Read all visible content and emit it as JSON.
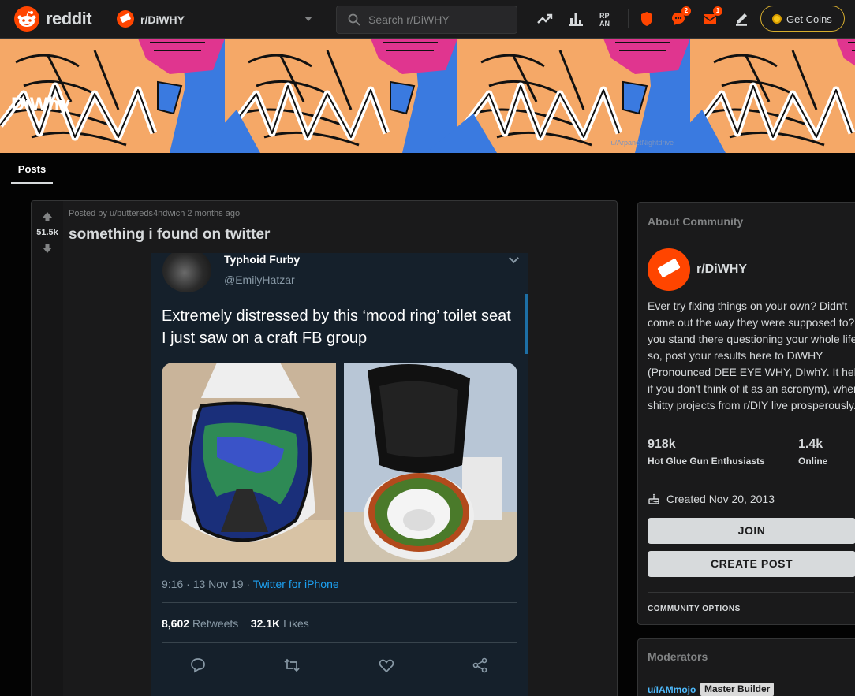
{
  "header": {
    "logo_text": "reddit",
    "community": "r/DiWHY",
    "search_placeholder": "Search r/DiWHY",
    "chat_badge": "2",
    "inbox_badge": "1",
    "coins_label": "Get Coins"
  },
  "banner": {
    "title": "DiWhy",
    "credit": "u/ArpanetNightdrive",
    "colors": {
      "skin": "#f5a867",
      "blue": "#3a7ae0",
      "pink": "#e0358f",
      "lines": "#111111",
      "letters": "#ffffff"
    }
  },
  "tabs": {
    "posts": "Posts"
  },
  "post": {
    "meta": "Posted by u/buttereds4ndwich 2 months ago",
    "votes": "51.5k",
    "title": "something i found on twitter"
  },
  "tweet": {
    "name": "Typhoid Furby",
    "handle": "@EmilyHatzar",
    "text": "Extremely distressed by this ‘mood ring’ toilet seat I just saw on a craft FB group",
    "time": "9:16 · 13 Nov 19 · ",
    "source": "Twitter for iPhone",
    "retweets": "8,602",
    "retweets_label": "Retweets",
    "likes": "32.1K",
    "likes_label": "Likes"
  },
  "about": {
    "header": "About Community",
    "name": "r/DiWHY",
    "description": "Ever try fixing things on your own? Didn't come out the way they were supposed to? Do you stand there questioning your whole life? If so, post your results here to DiWHY (Pronounced DEE EYE WHY, DIwhY. It helps if you don't think of it as an acronym), where shitty projects from r/DIY live prosperously.",
    "members": "918k",
    "members_label": "Hot Glue Gun Enthusiasts",
    "online": "1.4k",
    "online_label": "Online",
    "created": "Created Nov 20, 2013",
    "join": "JOIN",
    "create_post": "CREATE POST",
    "options": "COMMUNITY OPTIONS"
  },
  "moderators": {
    "header": "Moderators",
    "user": "u/IAMmojo",
    "flair": "Master Builder"
  },
  "colors": {
    "accent": "#ff4500",
    "background": "#030303",
    "card": "#1a1a1b",
    "link": "#4fbcff",
    "tweet_bg": "#15202b"
  }
}
